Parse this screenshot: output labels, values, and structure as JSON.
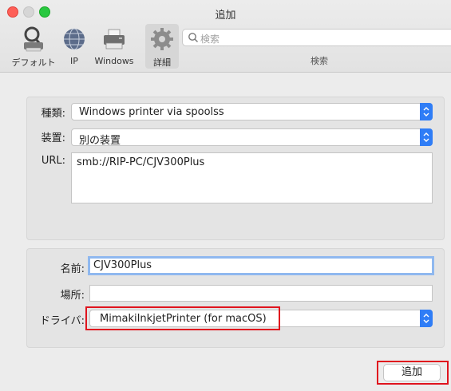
{
  "window": {
    "title": "追加"
  },
  "toolbar": {
    "items": [
      {
        "label": "デフォルト",
        "icon": "default-printer-icon"
      },
      {
        "label": "IP",
        "icon": "globe-icon"
      },
      {
        "label": "Windows",
        "icon": "windows-printer-icon"
      },
      {
        "label": "詳細",
        "icon": "gear-icon",
        "selected": true
      }
    ],
    "search_placeholder": "検索",
    "search_label": "検索"
  },
  "advanced": {
    "type_label": "種類:",
    "type_value": "Windows printer via spoolss",
    "device_label": "装置:",
    "device_value": "別の装置",
    "url_label": "URL:",
    "url_value": "smb://RIP-PC/CJV300Plus"
  },
  "printer": {
    "name_label": "名前:",
    "name_value": "CJV300Plus",
    "location_label": "場所:",
    "location_value": "",
    "driver_label": "ドライバ:",
    "driver_value": "MimakiInkjetPrinter (for macOS)"
  },
  "actions": {
    "add_label": "追加"
  },
  "colors": {
    "accent": "#2f7df6",
    "highlight": "#e0141e",
    "focus_ring": "#8fb8ef"
  }
}
